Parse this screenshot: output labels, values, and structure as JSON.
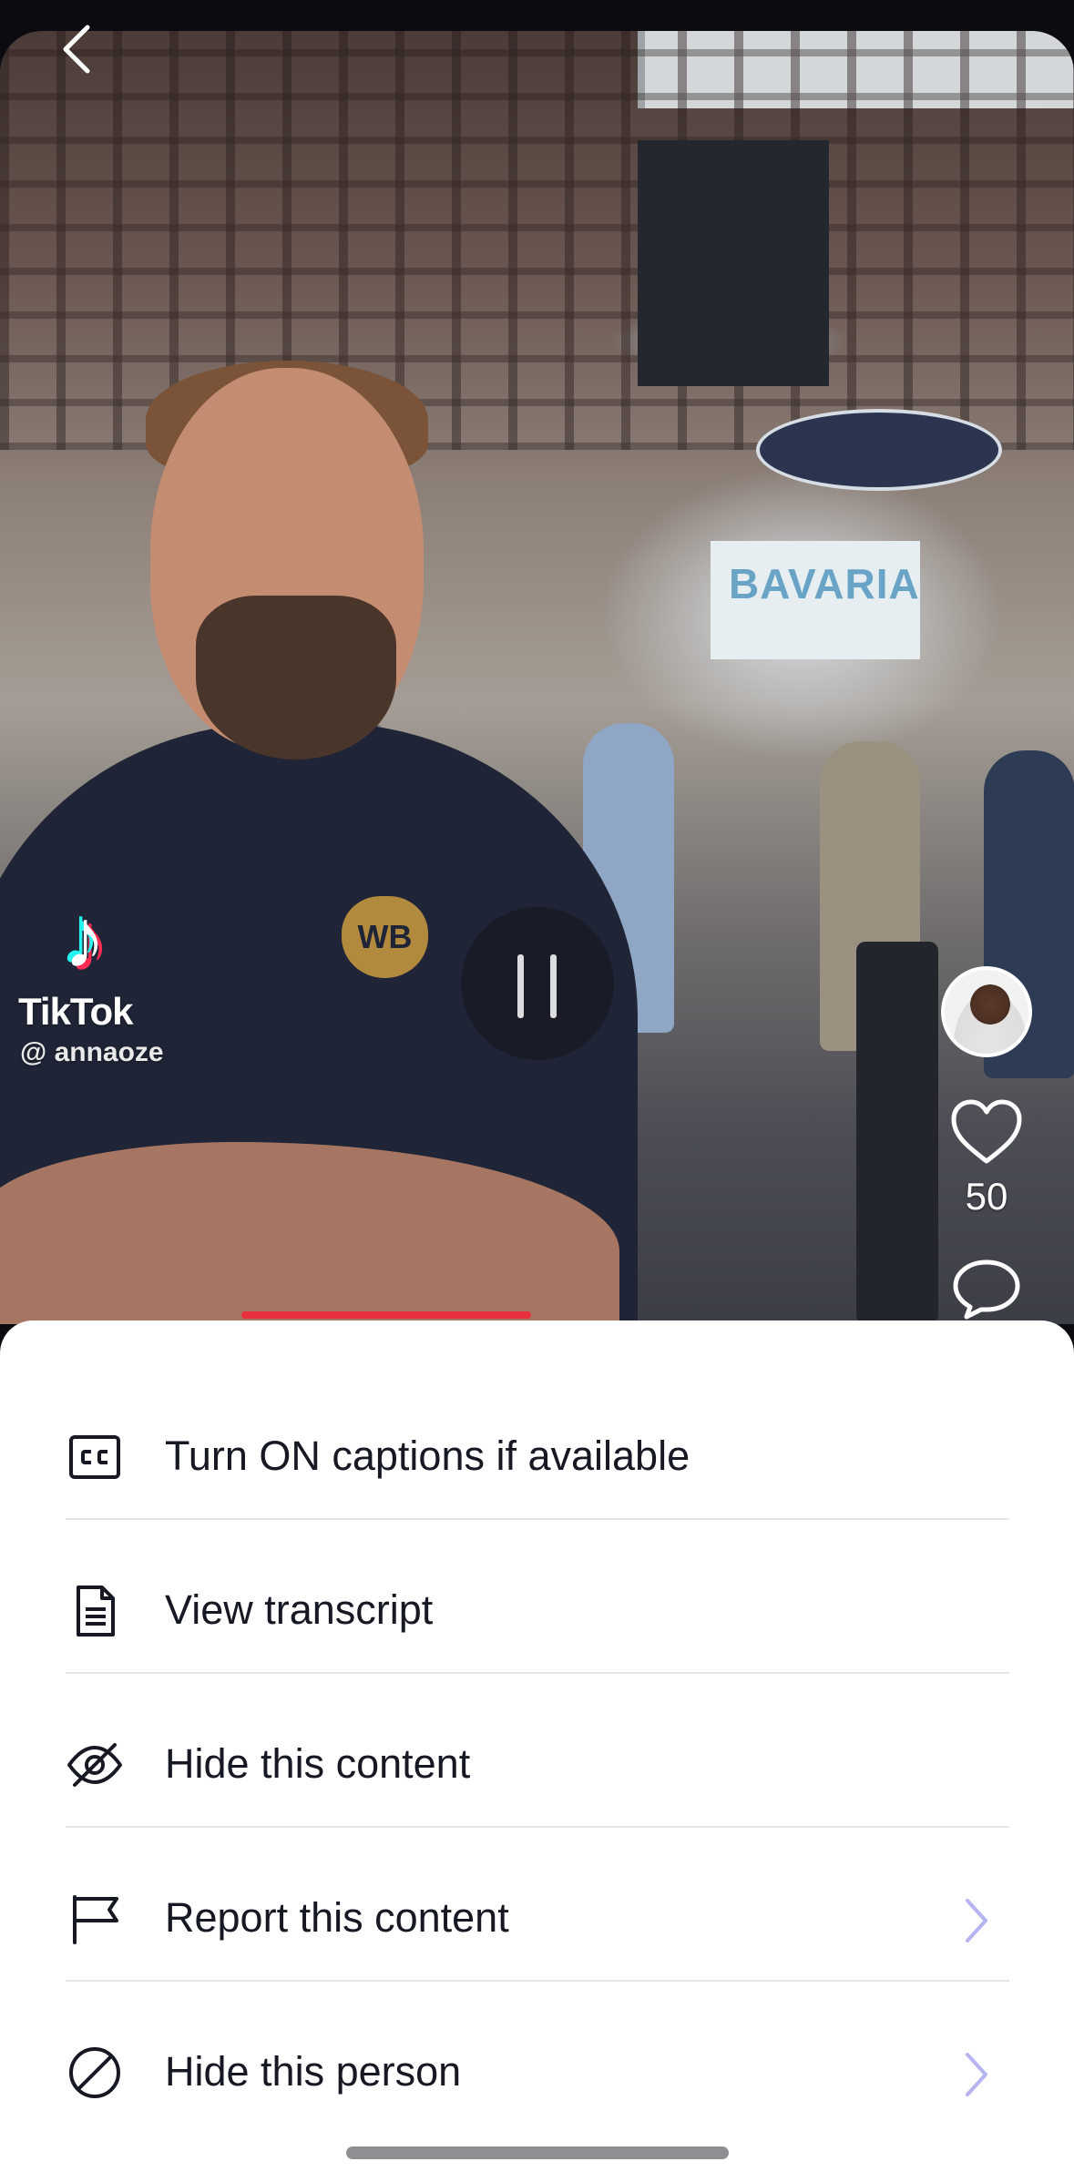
{
  "video": {
    "watermark": {
      "brand": "TikTok",
      "handle": "@ annaoze"
    },
    "booth_sign": "BAVARIA",
    "shirt_logo": "WB",
    "like_count": "50",
    "progress_fraction": 0.49
  },
  "menu": {
    "items": [
      {
        "label": "Turn ON captions if available",
        "icon": "closed-captions-icon",
        "chevron": false
      },
      {
        "label": "View transcript",
        "icon": "document-icon",
        "chevron": false
      },
      {
        "label": "Hide this content",
        "icon": "eye-slash-icon",
        "chevron": false
      },
      {
        "label": "Report this content",
        "icon": "flag-icon",
        "chevron": true
      },
      {
        "label": "Hide this person",
        "icon": "block-icon",
        "chevron": true
      }
    ]
  },
  "colors": {
    "sheet_bg": "#ffffff",
    "text": "#161823",
    "divider": "#e6e6ea",
    "chevron": "#b7b4f2",
    "progress": "#e8303f"
  }
}
